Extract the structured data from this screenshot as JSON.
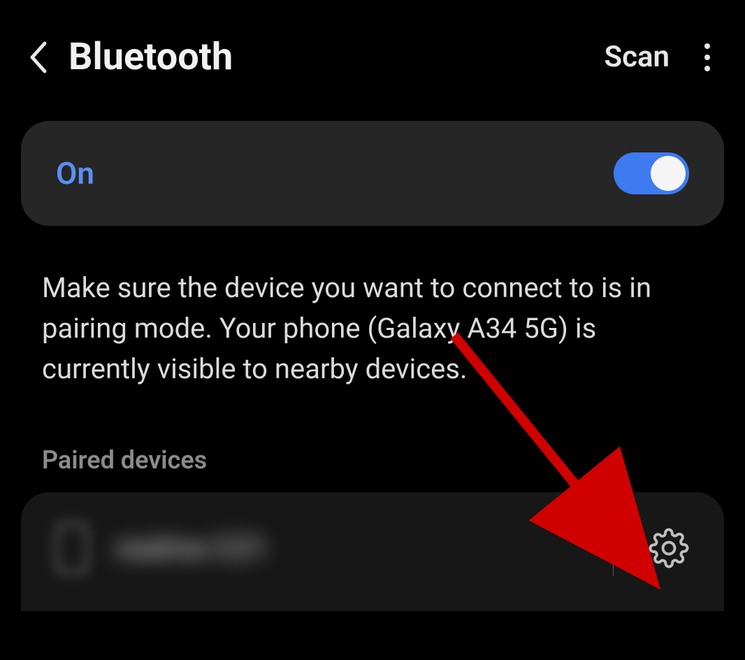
{
  "header": {
    "title": "Bluetooth",
    "scan_label": "Scan"
  },
  "toggle": {
    "label": "On",
    "state": true
  },
  "help_text": "Make sure the device you want to connect to is in pairing mode. Your phone (Galaxy A34 5G) is currently visible to nearby devices.",
  "section_label": "Paired devices",
  "device": {
    "name": "realme C21"
  },
  "colors": {
    "accent": "#3e7af0",
    "accent_text": "#5b8ff0"
  }
}
